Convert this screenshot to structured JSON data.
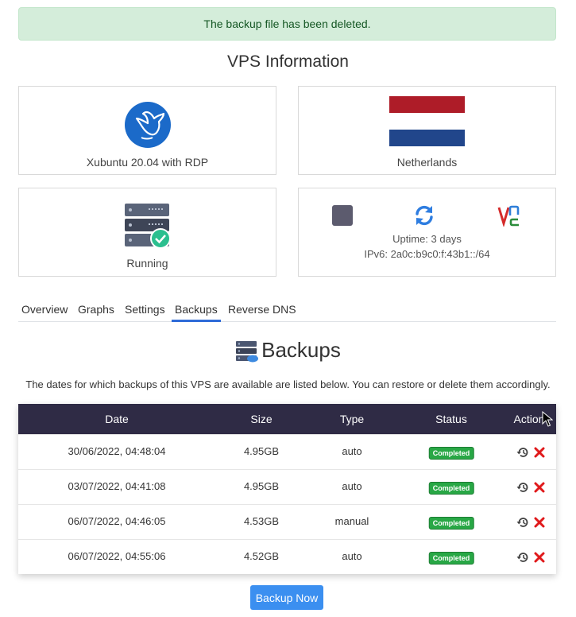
{
  "alert": {
    "message": "The backup file has been deleted."
  },
  "page_title": "VPS Information",
  "cards": {
    "os": {
      "label": "Xubuntu 20.04 with RDP",
      "icon": "xubuntu-logo-icon"
    },
    "location": {
      "label": "Netherlands",
      "icon": "netherlands-flag-icon"
    },
    "status": {
      "label": "Running",
      "icon": "server-running-icon"
    },
    "controls": {
      "uptime_label": "Uptime:",
      "uptime_value": "3 days",
      "ipv6_label": "IPv6:",
      "ipv6_value": "2a0c:b9c0:f:43b1::/64"
    }
  },
  "tabs": [
    {
      "label": "Overview",
      "active": false
    },
    {
      "label": "Graphs",
      "active": false
    },
    {
      "label": "Settings",
      "active": false
    },
    {
      "label": "Backups",
      "active": true
    },
    {
      "label": "Reverse DNS",
      "active": false
    }
  ],
  "backups": {
    "title": "Backups",
    "description": "The dates for which backups of this VPS are available are listed below. You can restore or delete them accordingly.",
    "columns": {
      "date": "Date",
      "size": "Size",
      "type": "Type",
      "status": "Status",
      "action": "Action"
    },
    "rows": [
      {
        "date": "30/06/2022, 04:48:04",
        "size": "4.95GB",
        "type": "auto",
        "status": "Completed"
      },
      {
        "date": "03/07/2022, 04:41:08",
        "size": "4.95GB",
        "type": "auto",
        "status": "Completed"
      },
      {
        "date": "06/07/2022, 04:46:05",
        "size": "4.53GB",
        "type": "manual",
        "status": "Completed"
      },
      {
        "date": "06/07/2022, 04:55:06",
        "size": "4.52GB",
        "type": "auto",
        "status": "Completed"
      }
    ],
    "backup_now_label": "Backup Now"
  },
  "colors": {
    "header_bg": "#2f2b45",
    "accent": "#3b8ff0",
    "success": "#28a745",
    "delete": "#e0191b"
  }
}
